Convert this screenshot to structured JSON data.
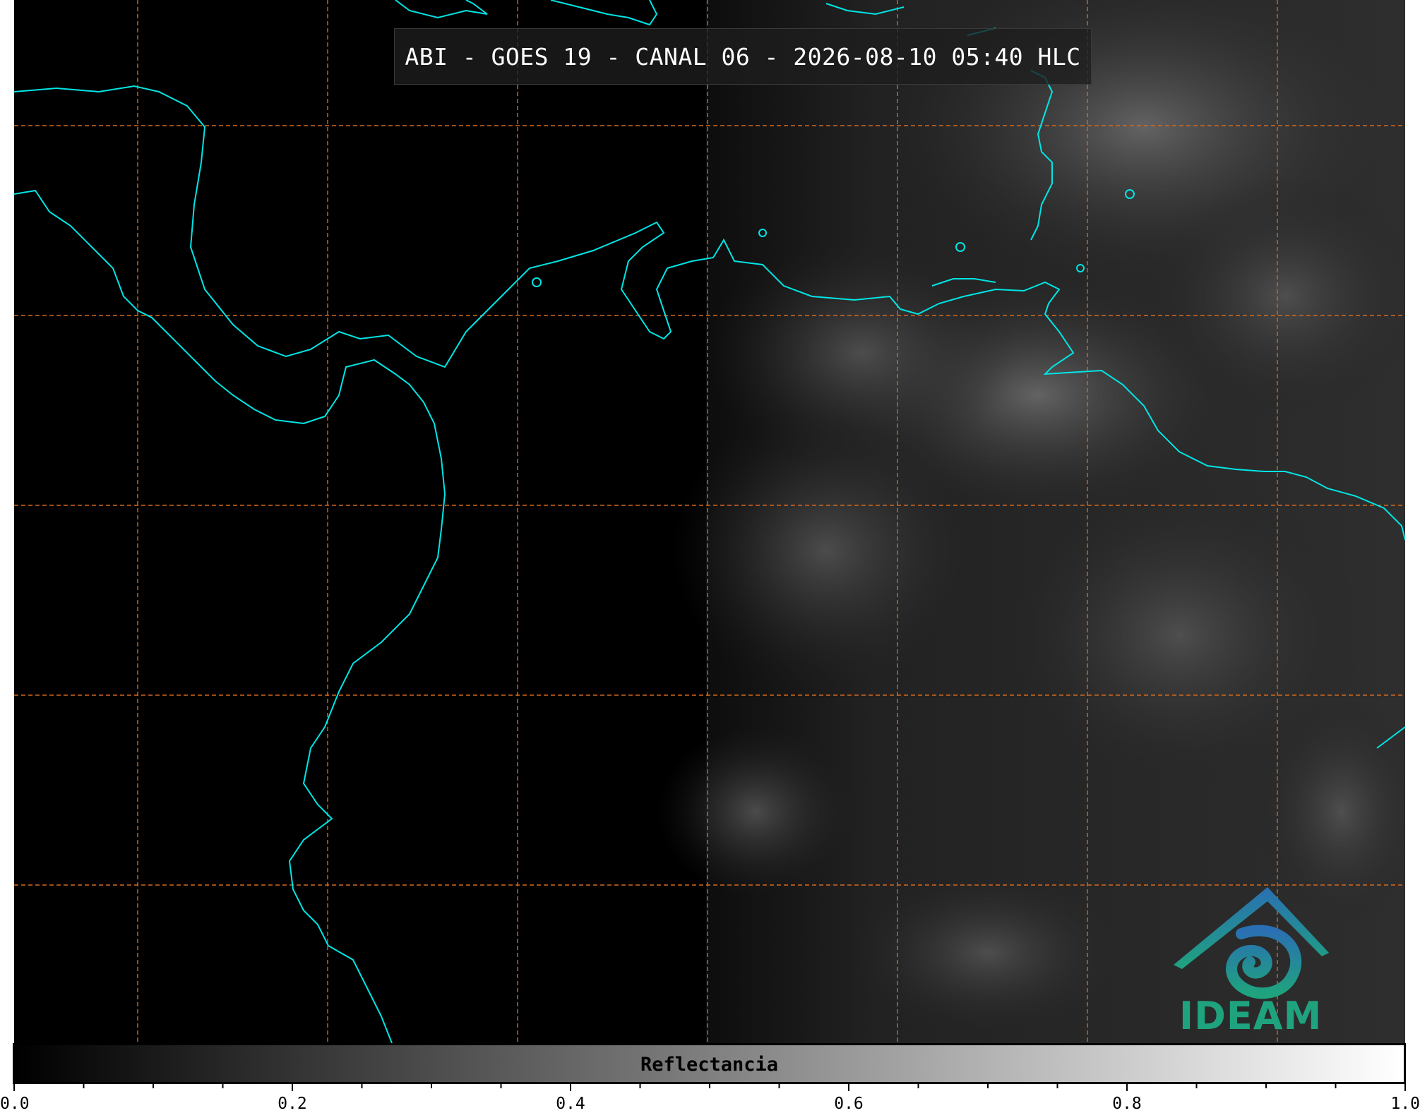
{
  "title": "ABI - GOES 19 - CANAL 06 - 2026-08-10 05:40 HLC",
  "logo": {
    "text": "IDEAM"
  },
  "colorbar": {
    "label": "Reflectancia",
    "min": 0.0,
    "max": 1.0,
    "tick_labels": [
      "0.0",
      "0.2",
      "0.4",
      "0.6",
      "0.8",
      "1.0"
    ],
    "minor_tick_step": 0.05
  },
  "colors": {
    "coastline": "#00e5e5",
    "gridline": "#d2691e",
    "background": "#000000",
    "logo_blue": "#2a6fb3",
    "logo_teal": "#1fa37e"
  },
  "grid": {
    "style": "dashed",
    "vertical_lines": 7,
    "horizontal_lines": 5
  }
}
